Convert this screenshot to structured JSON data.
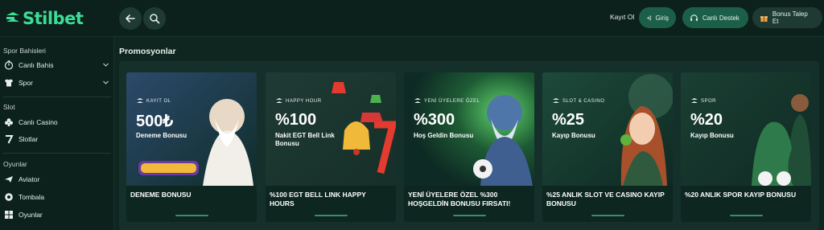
{
  "brand": {
    "logo_text": "Stilbet"
  },
  "header": {
    "register_label": "Kayıt Ol",
    "login_label": "Giriş",
    "support_label": "Canlı Destek",
    "bonus_request_label": "Bonus Talep Et"
  },
  "sidebar": {
    "sections": [
      {
        "title": "Spor Bahisleri",
        "items": [
          {
            "label": "Canlı Bahis",
            "icon": "live-bet-icon"
          },
          {
            "label": "Spor",
            "icon": "jersey-icon"
          }
        ]
      },
      {
        "title": "Slot",
        "items": [
          {
            "label": "Canlı Casino",
            "icon": "club-icon"
          },
          {
            "label": "Slotlar",
            "icon": "seven-icon"
          }
        ]
      },
      {
        "title": "Oyunlar",
        "items": [
          {
            "label": "Aviator",
            "icon": "plane-icon"
          },
          {
            "label": "Tombala",
            "icon": "ball-icon"
          },
          {
            "label": "Oyunlar",
            "icon": "games-icon"
          }
        ]
      }
    ]
  },
  "main": {
    "title": "Promosyonlar",
    "cards": [
      {
        "tag": "KAYIT OL",
        "big": "500₺",
        "sub": "Deneme Bonusu",
        "title": "DENEME BONUSU"
      },
      {
        "tag": "HAPPY HOUR",
        "big": "%100",
        "sub": "Nakit EGT Bell Link Bonusu",
        "title": "%100 EGT BELL LINK HAPPY HOURS"
      },
      {
        "tag": "YENİ ÜYELERE ÖZEL",
        "big": "%300",
        "sub": "Hoş Geldin Bonusu",
        "title": "YENİ ÜYELERE ÖZEL %300 HOŞGELDİN BONUSU FIRSATI!"
      },
      {
        "tag": "SLOT & CASINO",
        "big": "%25",
        "sub": "Kayıp Bonusu",
        "title": "%25 ANLIK SLOT VE CASINO KAYIP BONUSU"
      },
      {
        "tag": "SPOR",
        "big": "%20",
        "sub": "Kayıp Bonusu",
        "title": "%20 ANLIK SPOR KAYIP BONUSU"
      }
    ]
  },
  "colors": {
    "accent": "#3ddc97",
    "primary_button": "#1c5f48",
    "background": "#0f2620"
  }
}
